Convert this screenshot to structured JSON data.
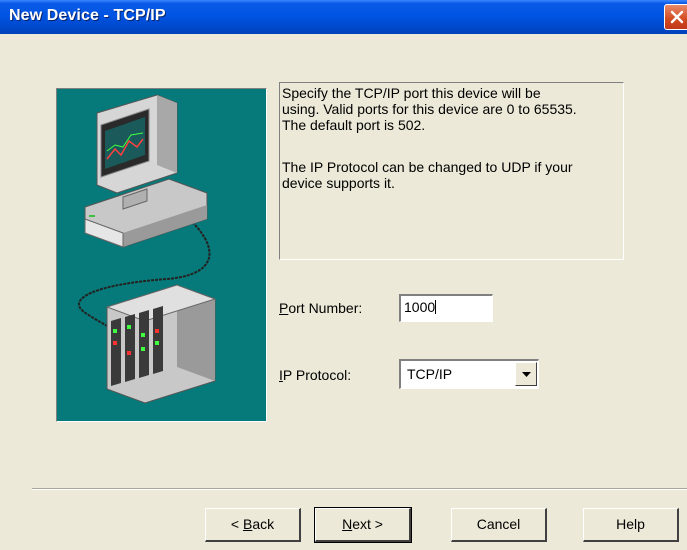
{
  "window": {
    "title": "New Device - TCP/IP"
  },
  "info": {
    "line1": "Specify the TCP/IP port this device will be\nusing.  Valid ports for this device are 0 to 65535.\nThe default port is 502.",
    "line2": "The IP Protocol can be changed to UDP if your\ndevice supports it."
  },
  "port": {
    "label_accel": "P",
    "label_rest": "ort Number:",
    "value": "1000"
  },
  "protocol": {
    "label_accel": "I",
    "label_rest": "P Protocol:",
    "value": "TCP/IP"
  },
  "buttons": {
    "back_prefix": "< ",
    "back_accel": "B",
    "back_rest": "ack",
    "next_accel": "N",
    "next_rest": "ext >",
    "cancel": "Cancel",
    "help": "Help"
  },
  "colors": {
    "titlebar": "#0054e3",
    "art_bg": "#067a7a",
    "dialog_bg": "#ece9d8"
  },
  "icons": [
    "close-icon",
    "computer-icon",
    "plc-device-icon",
    "dropdown-arrow-icon"
  ]
}
